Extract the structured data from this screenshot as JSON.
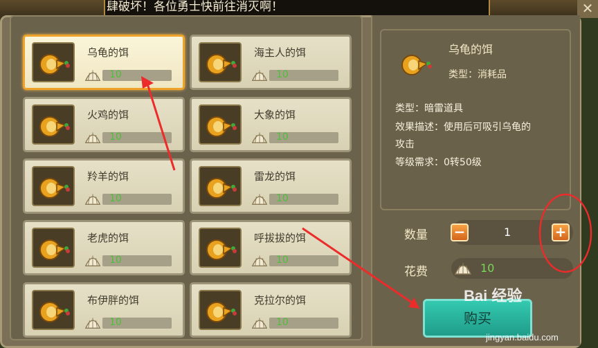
{
  "banner": {
    "text": "肆破坏！各位勇士快前往消灭啊！"
  },
  "close_label": "✕",
  "items": [
    {
      "name": "乌龟的饵",
      "price": "10"
    },
    {
      "name": "海主人的饵",
      "price": "10"
    },
    {
      "name": "火鸡的饵",
      "price": "10"
    },
    {
      "name": "大象的饵",
      "price": "10"
    },
    {
      "name": "羚羊的饵",
      "price": "10"
    },
    {
      "name": "雷龙的饵",
      "price": "10"
    },
    {
      "name": "老虎的饵",
      "price": "10"
    },
    {
      "name": "呼拔拔的饵",
      "price": "10"
    },
    {
      "name": "布伊胖的饵",
      "price": "10"
    },
    {
      "name": "克拉尔的饵",
      "price": "10"
    }
  ],
  "detail": {
    "name": "乌龟的饵",
    "category": "类型：消耗品",
    "type_line": "类型：暗雷道具",
    "effect_line1": "效果描述：使用后可吸引乌龟的",
    "effect_line2": "攻击",
    "level_line": "等级需求：0转50级"
  },
  "purchase": {
    "qty_label": "数量",
    "qty_value": "1",
    "minus": "−",
    "plus": "+",
    "cost_label": "花费",
    "cost_value": "10",
    "buy_label": "购买"
  },
  "watermark": {
    "brand": "Bai 经验",
    "url": "jingyan.baidu.com"
  },
  "colors": {
    "accent": "#f0a32a",
    "price": "#4dbf38",
    "buy": "#2bb39e"
  }
}
